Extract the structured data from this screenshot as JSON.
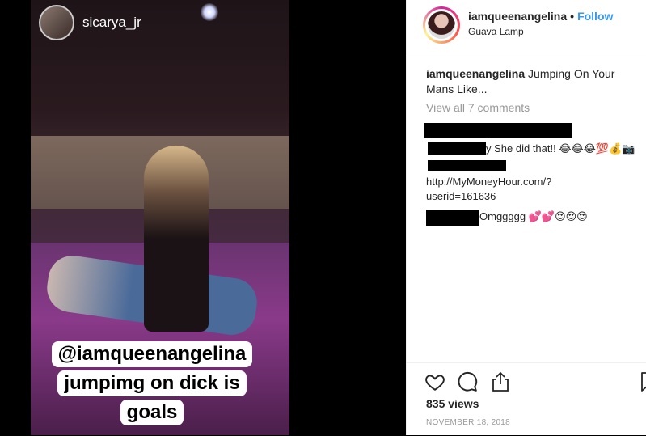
{
  "story": {
    "username": "sicarya_jr",
    "caption_lines": [
      "@iamqueenangelina",
      "jumpimg on dick is",
      "goals"
    ]
  },
  "post": {
    "author": "iamqueenangelina",
    "separator": "•",
    "follow_label": "Follow",
    "location": "Guava Lamp",
    "caption_user": "iamqueenangelina",
    "caption_text": "Jumping On Your Mans Like...",
    "view_all_comments": "View all 7 comments"
  },
  "comments": [
    {
      "text": "y She did that!! 😂😂😂💯💰📷"
    },
    {
      "text_lines": [
        "http://MyMoneyHour.com/?",
        "userid=161636"
      ]
    },
    {
      "text": "Omggggg 💕💕😍😍😍"
    }
  ],
  "footer": {
    "views": "835 views",
    "date": "NOVEMBER 18, 2018"
  },
  "icons": [
    "heart-icon",
    "comment-icon",
    "share-icon",
    "bookmark-icon"
  ]
}
